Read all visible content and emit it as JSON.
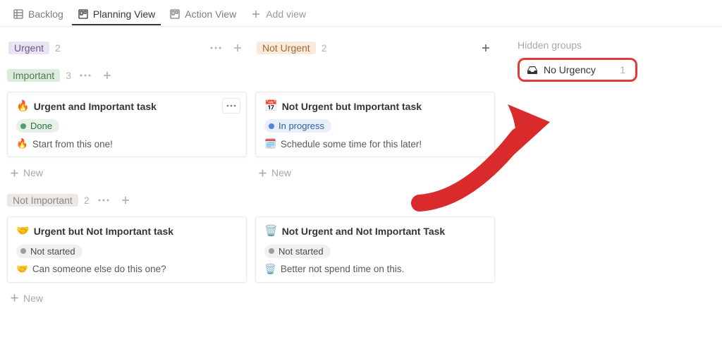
{
  "tabs": {
    "backlog": "Backlog",
    "planning": "Planning View",
    "action": "Action View",
    "add": "Add view"
  },
  "columns": {
    "urgent": {
      "label": "Urgent",
      "count": "2"
    },
    "not_urgent": {
      "label": "Not Urgent",
      "count": "2"
    }
  },
  "side": {
    "header": "Hidden groups",
    "no_urgency_label": "No Urgency",
    "no_urgency_count": "1"
  },
  "rows": {
    "important": {
      "label": "Important",
      "count": "3"
    },
    "not_important": {
      "label": "Not Important",
      "count": "2"
    }
  },
  "cards": {
    "c11": {
      "title_emoji": "🔥",
      "title": "Urgent and Important task",
      "status": "Done",
      "desc_emoji": "🔥",
      "desc": "Start from this one!"
    },
    "c12": {
      "title_emoji": "📅",
      "title": "Not Urgent but Important task",
      "status": "In progress",
      "desc_emoji": "🗓️",
      "desc": "Schedule some time for this later!"
    },
    "c21": {
      "title_emoji": "🤝",
      "title": "Urgent but Not Important task",
      "status": "Not started",
      "desc_emoji": "🤝",
      "desc": "Can someone else do this one?"
    },
    "c22": {
      "title_emoji": "🗑️",
      "title": "Not Urgent and Not Important Task",
      "status": "Not started",
      "desc_emoji": "🗑️",
      "desc": "Better not spend time on this."
    }
  },
  "ui": {
    "new": "New"
  }
}
